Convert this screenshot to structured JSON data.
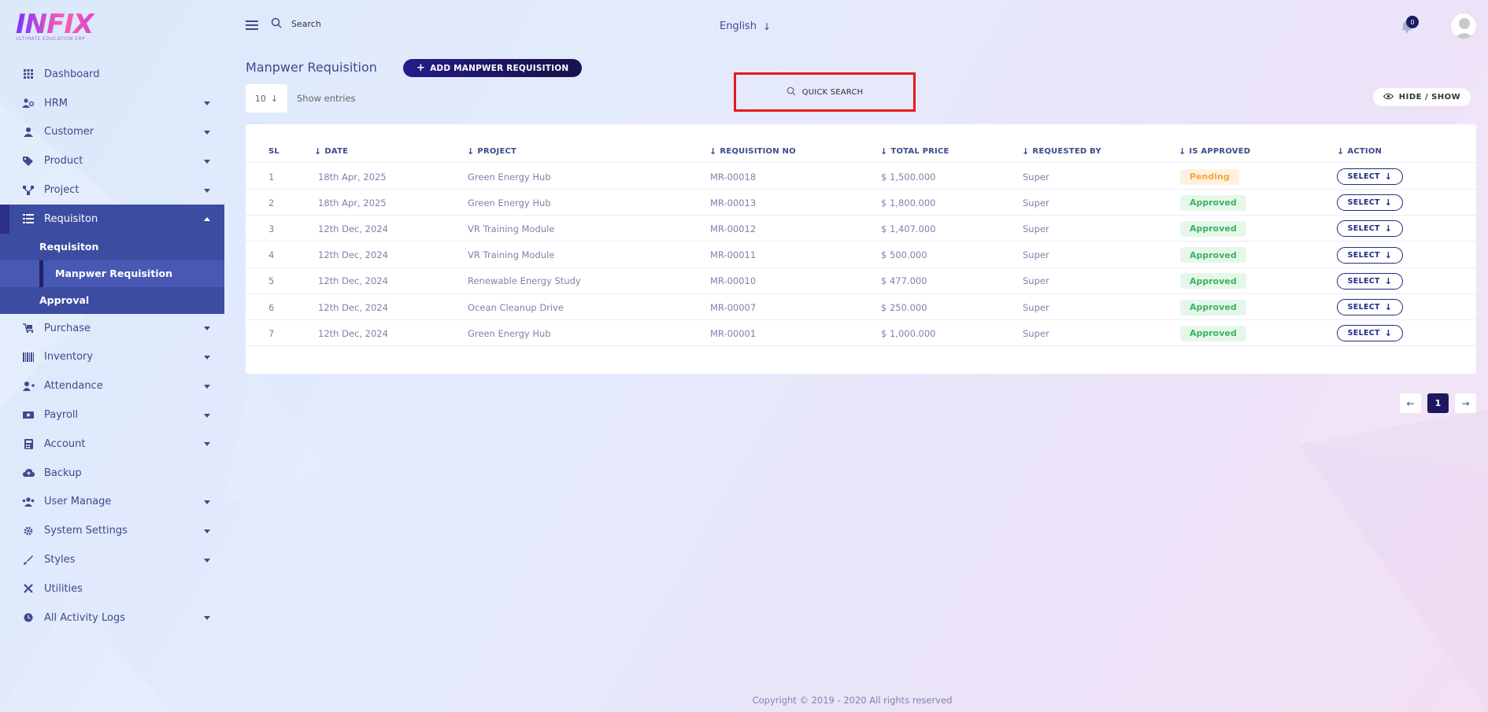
{
  "brand": {
    "logo_text": "INFIX",
    "logo_sub": "ULTIMATE EDUCATION ERP"
  },
  "topbar": {
    "search_label": "Search",
    "language": "English",
    "notification_count": "0"
  },
  "sidebar": {
    "items": [
      {
        "label": "Dashboard",
        "icon": "dashboard-icon",
        "has_caret": false
      },
      {
        "label": "HRM",
        "icon": "hrm-icon",
        "has_caret": true
      },
      {
        "label": "Customer",
        "icon": "customer-icon",
        "has_caret": true
      },
      {
        "label": "Product",
        "icon": "product-icon",
        "has_caret": true
      },
      {
        "label": "Project",
        "icon": "project-icon",
        "has_caret": true
      },
      {
        "label": "Requisiton",
        "icon": "requisition-icon",
        "has_caret": true,
        "active": true
      },
      {
        "label": "Purchase",
        "icon": "purchase-icon",
        "has_caret": true
      },
      {
        "label": "Inventory",
        "icon": "inventory-icon",
        "has_caret": true
      },
      {
        "label": "Attendance",
        "icon": "attendance-icon",
        "has_caret": true
      },
      {
        "label": "Payroll",
        "icon": "payroll-icon",
        "has_caret": true
      },
      {
        "label": "Account",
        "icon": "account-icon",
        "has_caret": true
      },
      {
        "label": "Backup",
        "icon": "backup-icon",
        "has_caret": false
      },
      {
        "label": "User Manage",
        "icon": "user-manage-icon",
        "has_caret": true
      },
      {
        "label": "System Settings",
        "icon": "settings-icon",
        "has_caret": true
      },
      {
        "label": "Styles",
        "icon": "styles-icon",
        "has_caret": true
      },
      {
        "label": "Utilities",
        "icon": "utilities-icon",
        "has_caret": false
      },
      {
        "label": "All Activity Logs",
        "icon": "activity-logs-icon",
        "has_caret": true
      }
    ],
    "submenu": {
      "requisition": "Requisiton",
      "manpower": "Manpwer Requisition",
      "approval": "Approval"
    }
  },
  "page": {
    "title": "Manpwer Requisition",
    "add_button": "ADD MANPWER REQUISITION",
    "entries_value": "10",
    "show_entries": "Show entries",
    "quick_search": "QUICK SEARCH",
    "hide_show": "HIDE / SHOW"
  },
  "table": {
    "headers": [
      "SL",
      "DATE",
      "PROJECT",
      "REQUISITION NO",
      "TOTAL PRICE",
      "REQUESTED BY",
      "IS APPROVED",
      "ACTION"
    ],
    "rows": [
      {
        "sl": "1",
        "date": "18th Apr, 2025",
        "project": "Green Energy Hub",
        "req_no": "MR-00018",
        "price": "$ 1,500.000",
        "by": "Super",
        "status": "Pending"
      },
      {
        "sl": "2",
        "date": "18th Apr, 2025",
        "project": "Green Energy Hub",
        "req_no": "MR-00013",
        "price": "$ 1,800.000",
        "by": "Super",
        "status": "Approved"
      },
      {
        "sl": "3",
        "date": "12th Dec, 2024",
        "project": "VR Training Module",
        "req_no": "MR-00012",
        "price": "$ 1,407.000",
        "by": "Super",
        "status": "Approved"
      },
      {
        "sl": "4",
        "date": "12th Dec, 2024",
        "project": "VR Training Module",
        "req_no": "MR-00011",
        "price": "$ 500.000",
        "by": "Super",
        "status": "Approved"
      },
      {
        "sl": "5",
        "date": "12th Dec, 2024",
        "project": "Renewable Energy Study",
        "req_no": "MR-00010",
        "price": "$ 477.000",
        "by": "Super",
        "status": "Approved"
      },
      {
        "sl": "6",
        "date": "12th Dec, 2024",
        "project": "Ocean Cleanup Drive",
        "req_no": "MR-00007",
        "price": "$ 250.000",
        "by": "Super",
        "status": "Approved"
      },
      {
        "sl": "7",
        "date": "12th Dec, 2024",
        "project": "Green Energy Hub",
        "req_no": "MR-00001",
        "price": "$ 1,000.000",
        "by": "Super",
        "status": "Approved"
      }
    ],
    "action_label": "SELECT"
  },
  "pagination": {
    "current": "1"
  },
  "footer": "Copyright © 2019 - 2020 All rights reserved",
  "colors": {
    "accent": "#1c1760",
    "sidebar_active": "#3c4ca1",
    "approved": "#3bb360",
    "pending": "#f5a63d",
    "highlight": "#e51a1a"
  }
}
